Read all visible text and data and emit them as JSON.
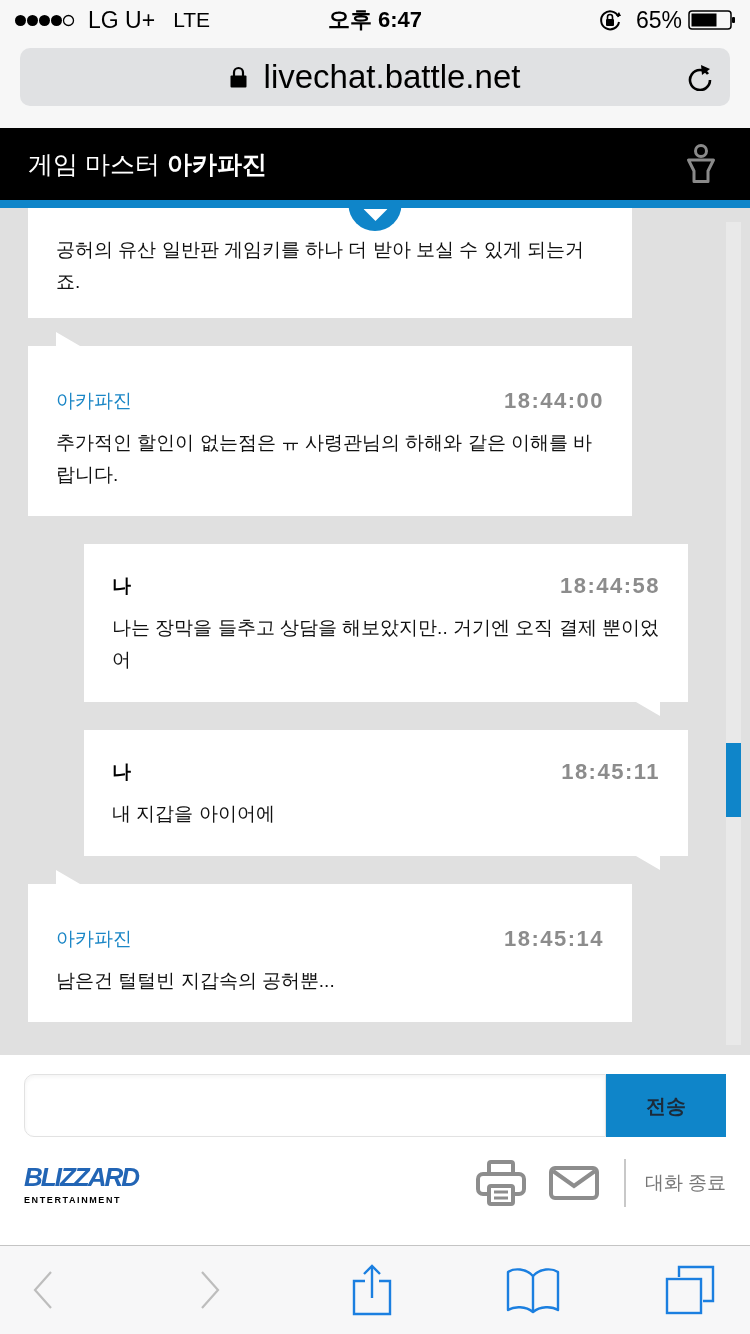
{
  "status_bar": {
    "carrier": "LG U+",
    "network": "LTE",
    "time": "오후 6:47",
    "battery": "65%"
  },
  "address_bar": {
    "url": "livechat.battle.net"
  },
  "chat_header": {
    "title": "게임 마스터 **아카파진**"
  },
  "messages": [
    {
      "kind": "continued",
      "text": "공허의 유산 일반판 게임키를 하나 더 받아 보실 수 있게 되는거죠."
    },
    {
      "kind": "agent",
      "sender": "아카파진",
      "time": "18:44:00",
      "text": "추가적인 할인이 없는점은 ㅠ 사령관님의 하해와 같은 이해를 바랍니다."
    },
    {
      "kind": "user",
      "sender": "나",
      "time": "18:44:58",
      "text": "나는 장막을 들추고 상담을 해보았지만.. 거기엔 오직 결제 뿐이었어"
    },
    {
      "kind": "user",
      "sender": "나",
      "time": "18:45:11",
      "text": "내 지갑을 아이어에"
    },
    {
      "kind": "agent",
      "sender": "아카파진",
      "time": "18:45:14",
      "text": "남은건 털털빈 지갑속의 공허뿐..."
    }
  ],
  "composer": {
    "send_button": "전송"
  },
  "footer": {
    "logo": "BLIZZARD",
    "logo_tagline": "ENTERTAINMENT",
    "end_chat": "대화 종료"
  },
  "browser_toolbar": {
    "back": {
      "disabled": true
    },
    "forward": {
      "disabled": true
    }
  }
}
